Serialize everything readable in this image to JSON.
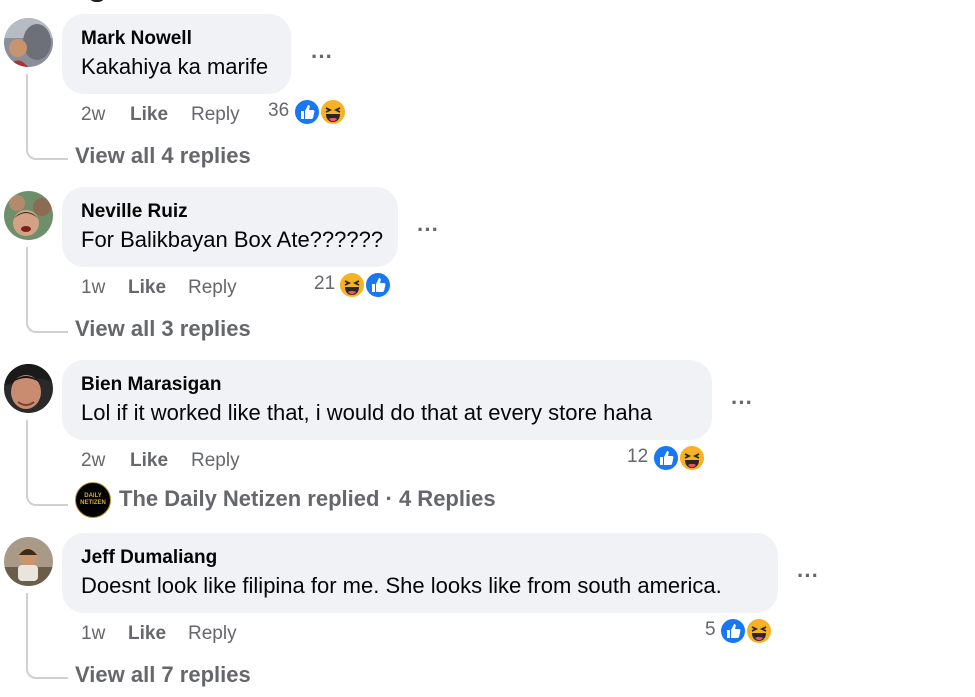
{
  "comments": [
    {
      "author": "Mark Nowell",
      "text": "Kakahiya ka marife",
      "time": "2w",
      "like": "Like",
      "reply": "Reply",
      "reaction_count": "36",
      "reactions": [
        "like-icon",
        "haha-icon"
      ],
      "view_replies": "View all 4 replies"
    },
    {
      "author": "Neville Ruiz",
      "text": "For Balikbayan Box Ate??????",
      "time": "1w",
      "like": "Like",
      "reply": "Reply",
      "reaction_count": "21",
      "reactions": [
        "haha-icon",
        "like-icon"
      ],
      "view_replies": "View all 3 replies"
    },
    {
      "author": "Bien Marasigan",
      "text": "Lol if it worked like that, i would do that at every store haha",
      "time": "2w",
      "like": "Like",
      "reply": "Reply",
      "reaction_count": "12",
      "reactions": [
        "like-icon",
        "haha-icon"
      ],
      "page_reply": "The Daily Netizen replied · 4 Replies",
      "page_logo_text": [
        "DAILY",
        "NETIZEN"
      ]
    },
    {
      "author": "Jeff Dumaliang",
      "text": "Doesnt look like filipina for me. She looks like from south america.",
      "time": "1w",
      "like": "Like",
      "reply": "Reply",
      "reaction_count": "5",
      "reactions": [
        "like-icon",
        "haha-icon"
      ],
      "view_replies": "View all 7 replies"
    }
  ],
  "more_label": "···",
  "colors": {
    "bubble": "#f0f2f5",
    "secondary_text": "#65676b",
    "like_blue": "#1877f2",
    "haha_yellow": "#f7b125"
  }
}
